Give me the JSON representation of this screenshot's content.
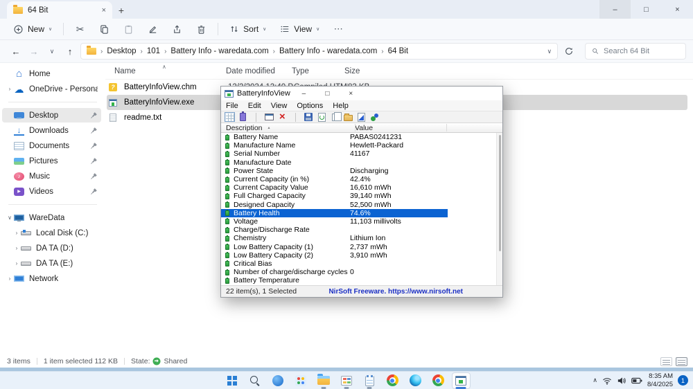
{
  "explorer": {
    "tab": {
      "title": "64 Bit",
      "close_glyph": "×",
      "new_tab_glyph": "+"
    },
    "window_controls": {
      "minimize": "–",
      "maximize": "□",
      "close": "×"
    },
    "toolbar": {
      "new_label": "New",
      "chevron": "∨",
      "cut_glyph": "✂",
      "sort_label": "Sort",
      "view_label": "View",
      "more_glyph": "⋯"
    },
    "nav": {
      "back": "←",
      "forward": "→",
      "history": "∨",
      "up": "↑"
    },
    "crumb_sep": "›",
    "breadcrumbs": [
      {
        "label": "Desktop"
      },
      {
        "label": "101"
      },
      {
        "label": "Battery Info - waredata.com"
      },
      {
        "label": "Battery Info - waredata.com"
      },
      {
        "label": "64 Bit"
      }
    ],
    "address_chevron": "∨",
    "search_placeholder": "Search 64 Bit",
    "columns": {
      "name": "Name",
      "date": "Date modified",
      "type": "Type",
      "size": "Size",
      "sort_glyph": "∧"
    },
    "files": [
      {
        "name": "BatteryInfoView.chm",
        "date": "12/2/2024 12:40 PM",
        "type": "Compiled HTML H...",
        "size": "83 KB",
        "icon": "chm",
        "cls": ""
      },
      {
        "name": "BatteryInfoView.exe",
        "date": "",
        "type": "",
        "size": "",
        "icon": "exe",
        "cls": "selected"
      },
      {
        "name": "readme.txt",
        "date": "",
        "type": "",
        "size": "",
        "icon": "txt",
        "cls": ""
      }
    ],
    "sidebar_top": [
      {
        "label": "Home",
        "icon": "home",
        "expander": "",
        "pin": false,
        "cls": ""
      },
      {
        "label": "OneDrive - Personal",
        "icon": "onedrive",
        "expander": "›",
        "pin": false,
        "cls": ""
      }
    ],
    "sidebar_pinned": [
      {
        "label": "Desktop",
        "icon": "desktop",
        "expander": "",
        "pin": true,
        "cls": "selected"
      },
      {
        "label": "Downloads",
        "icon": "downloads",
        "expander": "",
        "pin": true,
        "cls": ""
      },
      {
        "label": "Documents",
        "icon": "documents",
        "expander": "",
        "pin": true,
        "cls": ""
      },
      {
        "label": "Pictures",
        "icon": "pictures",
        "expander": "",
        "pin": true,
        "cls": ""
      },
      {
        "label": "Music",
        "icon": "music",
        "expander": "",
        "pin": true,
        "cls": ""
      },
      {
        "label": "Videos",
        "icon": "videos",
        "expander": "",
        "pin": true,
        "cls": ""
      }
    ],
    "sidebar_drives": [
      {
        "label": "WareData",
        "icon": "pc",
        "expander": "∨",
        "pin": false,
        "cls": ""
      },
      {
        "label": "Local Disk (C:)",
        "icon": "disk-os",
        "expander": "›",
        "pin": false,
        "cls": "indent"
      },
      {
        "label": "DA TA (D:)",
        "icon": "disk",
        "expander": "›",
        "pin": false,
        "cls": "indent"
      },
      {
        "label": "DA TA (E:)",
        "icon": "disk",
        "expander": "›",
        "pin": false,
        "cls": "indent"
      },
      {
        "label": "Network",
        "icon": "network",
        "expander": "›",
        "pin": false,
        "cls": ""
      }
    ],
    "status": {
      "items": "3 items",
      "selected": "1 item selected 112 KB",
      "state_label": "State:",
      "state_value": "Shared"
    }
  },
  "battery_app": {
    "title": "BatteryInfoView",
    "controls": {
      "minimize": "–",
      "maximize": "□",
      "close": "×"
    },
    "menu": [
      {
        "label": "File"
      },
      {
        "label": "Edit"
      },
      {
        "label": "View"
      },
      {
        "label": "Options"
      },
      {
        "label": "Help"
      }
    ],
    "toolbar_icons": [
      {
        "name": "report-grid-icon",
        "cls": "t-grid"
      },
      {
        "name": "battery-icon",
        "cls": "t-batt"
      },
      {
        "name": "toolbar-separator",
        "cls": "t-sep"
      },
      {
        "name": "window-mode-icon",
        "cls": "t-win"
      },
      {
        "name": "delete-red-x-icon",
        "cls": "t-x"
      },
      {
        "name": "toolbar-separator",
        "cls": "t-sep"
      },
      {
        "name": "save-icon",
        "cls": "t-save"
      },
      {
        "name": "refresh-icon",
        "cls": "t-refresh"
      },
      {
        "name": "copy-icon",
        "cls": "t-copy"
      },
      {
        "name": "properties-icon",
        "cls": "t-props"
      },
      {
        "name": "export-html-icon",
        "cls": "t-export"
      },
      {
        "name": "about-icon",
        "cls": "t-about"
      }
    ],
    "columns": {
      "desc": "Description",
      "value": "Value",
      "sort_glyph": "▴"
    },
    "rows": [
      {
        "desc": "Battery Name",
        "value": "PABAS0241231",
        "cls": ""
      },
      {
        "desc": "Manufacture Name",
        "value": "Hewlett-Packard",
        "cls": ""
      },
      {
        "desc": "Serial Number",
        "value": "41167",
        "cls": ""
      },
      {
        "desc": "Manufacture Date",
        "value": "",
        "cls": ""
      },
      {
        "desc": "Power State",
        "value": "Discharging",
        "cls": ""
      },
      {
        "desc": "Current Capacity (in %)",
        "value": "42.4%",
        "cls": ""
      },
      {
        "desc": "Current Capacity Value",
        "value": "16,610 mWh",
        "cls": ""
      },
      {
        "desc": "Full Charged Capacity",
        "value": "39,140 mWh",
        "cls": ""
      },
      {
        "desc": "Designed Capacity",
        "value": "52,500 mWh",
        "cls": ""
      },
      {
        "desc": "Battery Health",
        "value": "74.6%",
        "cls": "selected"
      },
      {
        "desc": "Voltage",
        "value": "11,103 millivolts",
        "cls": ""
      },
      {
        "desc": "Charge/Discharge Rate",
        "value": "",
        "cls": ""
      },
      {
        "desc": "Chemistry",
        "value": "Lithium Ion",
        "cls": ""
      },
      {
        "desc": "Low Battery Capacity (1)",
        "value": "2,737 mWh",
        "cls": ""
      },
      {
        "desc": "Low Battery Capacity (2)",
        "value": "3,910 mWh",
        "cls": ""
      },
      {
        "desc": "Critical Bias",
        "value": "",
        "cls": ""
      },
      {
        "desc": "Number of charge/discharge cycles",
        "value": "0",
        "cls": ""
      },
      {
        "desc": "Battery Temperature",
        "value": "",
        "cls": ""
      }
    ],
    "status": {
      "left": "22 item(s), 1 Selected",
      "right": "NirSoft Freeware. https://www.nirsoft.net"
    }
  },
  "taskbar": {
    "icons": [
      {
        "name": "start-button",
        "cls": "tb-start"
      },
      {
        "name": "search-button",
        "cls": "tb-search"
      },
      {
        "name": "copilot-icon",
        "cls": "tb-copilot"
      },
      {
        "name": "photos-icon",
        "cls": "tb-photos"
      },
      {
        "name": "file-explorer-icon",
        "cls": "tb-explorer open"
      },
      {
        "name": "app-window-icon",
        "cls": "tb-app open"
      },
      {
        "name": "notepad-icon",
        "cls": "tb-notepad open"
      },
      {
        "name": "chrome-icon",
        "cls": "tb-chrome"
      },
      {
        "name": "edge-icon",
        "cls": "tb-edge"
      },
      {
        "name": "chrome-icon-2",
        "cls": "tb-chrome"
      },
      {
        "name": "batteryinfoview-taskbar-icon",
        "cls": "tb-batteryinfo active"
      }
    ],
    "tray": {
      "expand_glyph": "∧",
      "time": "8:35 AM",
      "date": "8/4/2025",
      "badge": "1"
    }
  },
  "colors": {
    "selection_blue": "#0b63d2",
    "link_blue": "#1b2fc4",
    "shared_green": "#3fae54",
    "taskbar_accent": "#3a7bd5"
  }
}
